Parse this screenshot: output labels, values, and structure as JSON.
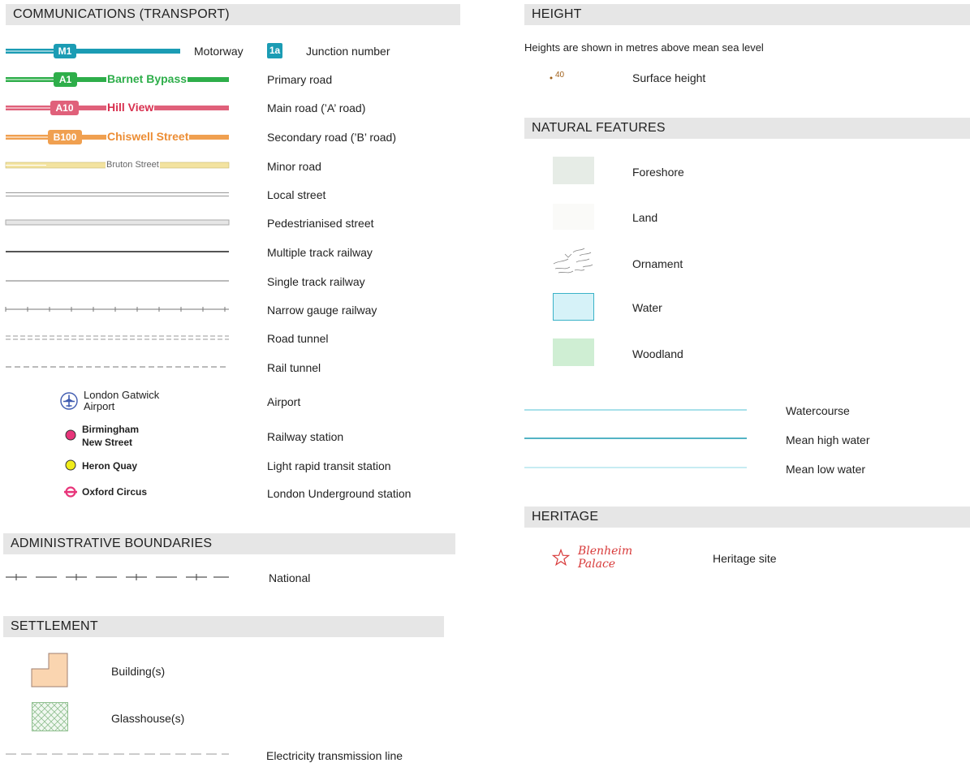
{
  "transport": {
    "header": "COMMUNICATIONS (TRANSPORT)",
    "motorway": {
      "badge": "M1",
      "label": "Motorway",
      "color": "#1b9cb4"
    },
    "junction": {
      "badge": "1a",
      "label": "Junction number",
      "color": "#1b9cb4"
    },
    "primary": {
      "badge": "A1",
      "name": "Barnet Bypass",
      "label": "Primary road",
      "color": "#2eae4a"
    },
    "main": {
      "badge": "A10",
      "name": "Hill View",
      "label": "Main road (’A’ road)",
      "color": "#e0607a"
    },
    "secondary": {
      "badge": "B100",
      "name": "Chiswell Street",
      "label": "Secondary road (’B’ road)",
      "color": "#f0a050"
    },
    "minor": {
      "name": "Bruton Street",
      "label": "Minor road",
      "color": "#f3e3a0"
    },
    "local": {
      "label": "Local street"
    },
    "pedestrian": {
      "label": "Pedestrianised street"
    },
    "multi_rail": {
      "label": "Multiple track railway"
    },
    "single_rail": {
      "label": "Single track railway"
    },
    "narrow_rail": {
      "label": "Narrow gauge railway"
    },
    "road_tunnel": {
      "label": "Road tunnel"
    },
    "rail_tunnel": {
      "label": "Rail tunnel"
    },
    "airport": {
      "name_line1": "London Gatwick",
      "name_line2": "Airport",
      "label": "Airport",
      "color": "#3f5bb0"
    },
    "railway_station": {
      "name_line1": "Birmingham",
      "name_line2": "New Street",
      "label": "Railway station",
      "color": "#e8357a"
    },
    "lrt": {
      "name": "Heron Quay",
      "label": "Light rapid transit station",
      "color": "#f0ec1a"
    },
    "underground": {
      "name": "Oxford Circus",
      "label": "London Underground station",
      "color": "#e8357a"
    }
  },
  "admin": {
    "header": "ADMINISTRATIVE BOUNDARIES",
    "national": {
      "label": "National"
    }
  },
  "settlement": {
    "header": "SETTLEMENT",
    "building": {
      "label": "Building(s)",
      "color": "#fad5b0"
    },
    "glasshouse": {
      "label": "Glasshouse(s)"
    },
    "electricity": {
      "label": "Electricity transmission line"
    }
  },
  "height": {
    "header": "HEIGHT",
    "note": "Heights are shown in metres above mean sea level",
    "surface": {
      "value": "40",
      "label": "Surface height",
      "color": "#a0601a"
    }
  },
  "natural": {
    "header": "NATURAL FEATURES",
    "foreshore": {
      "label": "Foreshore",
      "color": "#e6ece6"
    },
    "land": {
      "label": "Land",
      "color": "#fafaf8"
    },
    "ornament": {
      "label": "Ornament"
    },
    "water": {
      "label": "Water",
      "color": "#d6f2f8"
    },
    "woodland": {
      "label": "Woodland",
      "color": "#cfeed3"
    },
    "watercourse": {
      "label": "Watercourse"
    },
    "mean_high": {
      "label": "Mean high water"
    },
    "mean_low": {
      "label": "Mean low water"
    }
  },
  "heritage": {
    "header": "HERITAGE",
    "site": {
      "name_line1": "Blenheim",
      "name_line2": "Palace",
      "label": "Heritage site",
      "color": "#d83a3a"
    }
  }
}
